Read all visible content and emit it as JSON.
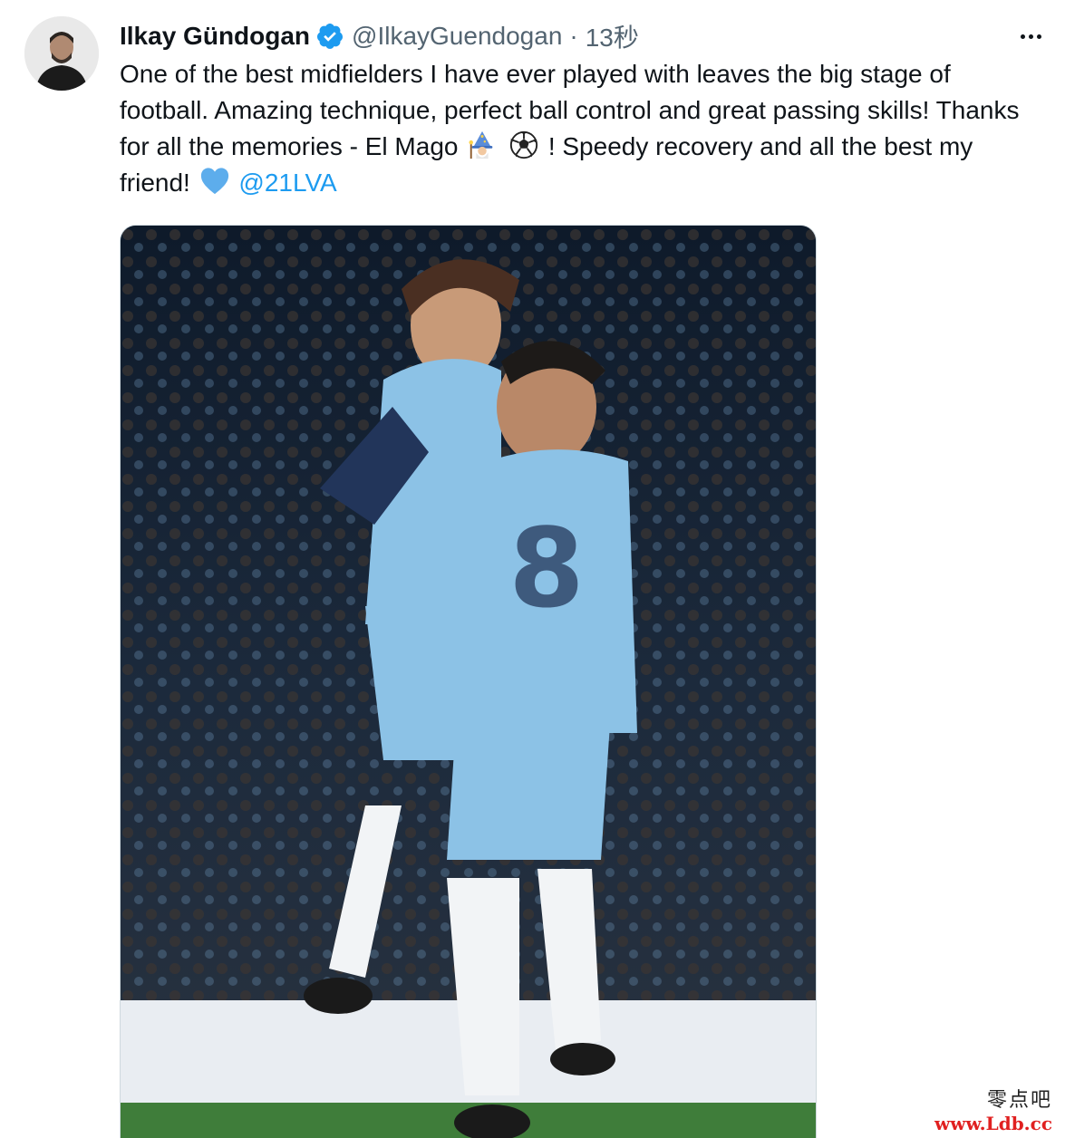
{
  "tweet": {
    "author_name": "Ilkay Gündogan",
    "handle": "@IlkayGuendogan",
    "separator": "·",
    "time": "13秒",
    "text_line1": "One of the best midfielders I have ever played with leaves the big stage of football. Amazing technique, perfect ball control and great passing skills! Thanks for all the memories - El Mago",
    "text_line2": "! Speedy recovery and all the best my friend!",
    "mention": "@21LVA",
    "verified_icon": "verified-badge-icon",
    "emojis": [
      "mage-emoji",
      "soccer-ball-emoji",
      "blue-heart-emoji"
    ]
  },
  "colors": {
    "accent": "#1d9bf0",
    "text": "#0f1419",
    "secondary": "#536471"
  },
  "watermark": {
    "top": "零点吧",
    "bottom": "www.Ldb.cc"
  }
}
